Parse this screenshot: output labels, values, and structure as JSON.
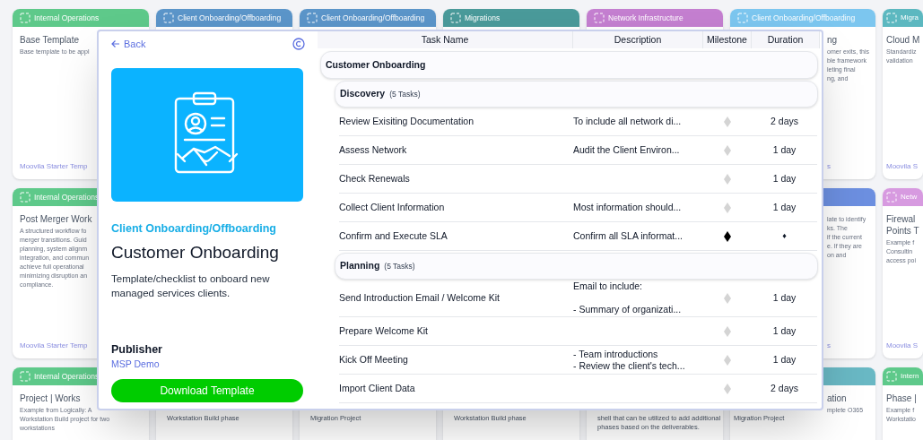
{
  "card_grid": [
    [
      {
        "kind": "full",
        "category": "Internal Operations",
        "color": "#5ec98a",
        "title_lines": [
          "Base Template"
        ],
        "description_lines": [
          "Base template to be appl"
        ],
        "footer": "Moovila Starter Temp"
      },
      {
        "kind": "covered",
        "category": "Client Onboarding/Offboarding",
        "color": "#5b95c9"
      },
      {
        "kind": "covered",
        "category": "Client Onboarding/Offboarding",
        "color": "#5b95c9"
      },
      {
        "kind": "covered",
        "category": "Migrations",
        "color": "#4a9a9a"
      },
      {
        "kind": "covered",
        "category": "Network Infrastructure",
        "color": "#c47fd0"
      },
      {
        "kind": "strip",
        "category": "Client Onboarding/Offboarding",
        "color": "#7cc6ef",
        "title_lines": [
          "ng"
        ],
        "description_lines": [
          "omer exits, this",
          "ble framework",
          "leting final",
          "ng, and"
        ],
        "footer": "s"
      },
      {
        "kind": "edge",
        "category": "Migra",
        "color": "#5cb8c0",
        "title_lines": [
          "Cloud M"
        ],
        "description_lines": [
          "Standardiz",
          "validation"
        ],
        "footer": "Moovila S"
      }
    ],
    [
      {
        "kind": "full",
        "category": "Internal Operations",
        "color": "#5ec98a",
        "title_lines": [
          "Post Merger Work"
        ],
        "description_lines": [
          "A structured workflow fo",
          "merger transitions. Guid",
          "planning, system alignm",
          "integration, and commun",
          "achieve full operational",
          "minimizing disruption an",
          "compliance."
        ],
        "footer": "Moovila Starter Temp"
      },
      {
        "kind": "covered"
      },
      {
        "kind": "covered"
      },
      {
        "kind": "covered"
      },
      {
        "kind": "covered"
      },
      {
        "kind": "strip",
        "color": "#6c8fe0",
        "description_lines": [
          "late to identify",
          "ks. The",
          "if the current",
          "e. If they are",
          "on and"
        ],
        "footer": "s"
      },
      {
        "kind": "edge",
        "category": "Netw",
        "color": "#d79ae0",
        "title_lines": [
          "Firewal",
          "Points T"
        ],
        "description_lines": [
          "Example f",
          "Consultin",
          "access poi"
        ],
        "footer": "Moovila S"
      }
    ],
    [
      {
        "kind": "full",
        "category": "Internal Operations",
        "color": "#5ec98a",
        "title_lines": [
          "Project | Works"
        ],
        "description_lines": [
          "Example from Logically: A",
          "Workstation Build project for two",
          "workstations"
        ]
      },
      {
        "kind": "covered",
        "bottom_lines": [
          "Workstation Build phase"
        ]
      },
      {
        "kind": "covered",
        "bottom_lines": [
          "Migration Project"
        ]
      },
      {
        "kind": "covered",
        "bottom_lines": [
          "Workstation Build phase"
        ]
      },
      {
        "kind": "covered",
        "bottom_lines": [
          "shell that can be utilized to add additional",
          "phases based on the deliverables."
        ]
      },
      {
        "kind": "strip",
        "color": "#69b8c4",
        "title_lines": [
          "ation"
        ],
        "description_lines": [
          "mplete O365"
        ],
        "bottom_lines": [
          "Migration Project"
        ]
      },
      {
        "kind": "edge",
        "category": "Intern",
        "color": "#5ec98a",
        "title_lines": [
          "Phase |"
        ],
        "description_lines": [
          "Example f",
          "Workstatio"
        ]
      }
    ]
  ],
  "modal": {
    "back": "Back",
    "category": "Client Onboarding/Offboarding",
    "title": "Customer Onboarding",
    "description": "Template/checklist to onboard new managed services clients.",
    "publisher_label": "Publisher",
    "publisher": "MSP Demo",
    "download": "Download Template",
    "columns": [
      "Task Name",
      "Description",
      "Milestone",
      "Duration"
    ],
    "group": "Customer Onboarding",
    "phases": [
      {
        "name": "Discovery",
        "count": "(5 Tasks)",
        "tasks": [
          {
            "name": "Review Exisiting Documentation",
            "description": [
              "To include all network di..."
            ],
            "milestone": false,
            "duration": "2 days"
          },
          {
            "name": "Assess Network",
            "description": [
              "Audit the Client Environ..."
            ],
            "milestone": false,
            "duration": "1 day"
          },
          {
            "name": "Check Renewals",
            "milestone": false,
            "duration": "1 day"
          },
          {
            "name": "Collect Client Information",
            "description": [
              "Most information should..."
            ],
            "milestone": false,
            "duration": "1 day"
          },
          {
            "name": "Confirm and Execute SLA",
            "description": [
              "Confirm all SLA informat..."
            ],
            "milestone": true,
            "duration": "♦"
          }
        ]
      },
      {
        "name": "Planning",
        "count": "(5 Tasks)",
        "tasks": [
          {
            "name": "Send Introduction Email / Welcome Kit",
            "description": [
              "Email to include:",
              "- Summary of organizati..."
            ],
            "spaced": true,
            "milestone": false,
            "duration": "1 day"
          },
          {
            "name": "Prepare Welcome Kit",
            "milestone": false,
            "duration": "1 day"
          },
          {
            "name": "Kick Off Meeting",
            "description": [
              "- Team introductions",
              "- Review the client's tech..."
            ],
            "milestone": false,
            "duration": "1 day"
          },
          {
            "name": "Import Client Data",
            "milestone": false,
            "duration": "2 days"
          }
        ]
      }
    ]
  }
}
